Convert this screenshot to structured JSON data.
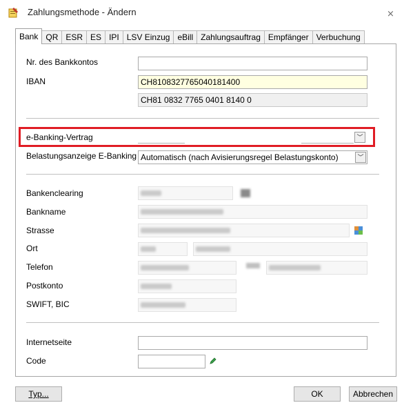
{
  "window": {
    "title": "Zahlungsmethode - Ändern",
    "close_glyph": "⨯",
    "icon": "form-edit-icon"
  },
  "tabs": [
    {
      "label": "Bank",
      "active": true
    },
    {
      "label": "QR"
    },
    {
      "label": "ESR"
    },
    {
      "label": "ES"
    },
    {
      "label": "IPI"
    },
    {
      "label": "LSV Einzug"
    },
    {
      "label": "eBill"
    },
    {
      "label": "Zahlungsauftrag"
    },
    {
      "label": "Empfänger"
    },
    {
      "label": "Verbuchung"
    }
  ],
  "form": {
    "account_no_label": "Nr. des Bankkontos",
    "account_no_value": "",
    "iban_label": "IBAN",
    "iban_value": "CH8108327765040181400",
    "iban_formatted": "CH81 0832 7765 0401 8140 0",
    "ebanking_label": "e-Banking-Vertrag",
    "ebanking_value": "",
    "belastung_label": "Belastungsanzeige E-Banking",
    "belastung_value": "Automatisch (nach Avisierungsregel Belastungskonto)",
    "bankenclearing_label": "Bankenclearing",
    "bankname_label": "Bankname",
    "strasse_label": "Strasse",
    "ort_label": "Ort",
    "telefon_label": "Telefon",
    "postkonto_label": "Postkonto",
    "swift_label": "SWIFT, BIC",
    "internetseite_label": "Internetseite",
    "internetseite_value": "",
    "code_label": "Code",
    "code_value": ""
  },
  "highlight_color": "#e01c24",
  "buttons": {
    "typ": "Typ...",
    "ok": "OK",
    "cancel": "Abbrechen"
  }
}
